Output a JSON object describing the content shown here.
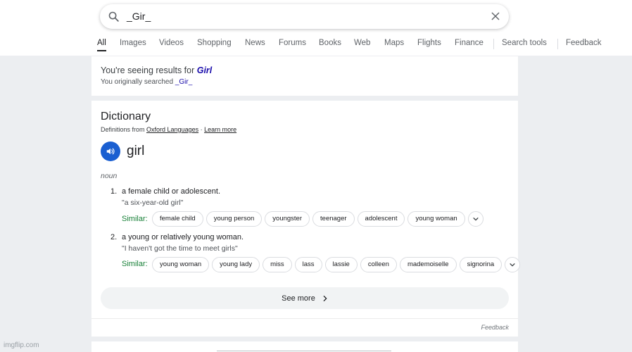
{
  "search": {
    "query": "_Gir_"
  },
  "tabs": [
    {
      "label": "All",
      "active": true
    },
    {
      "label": "Images"
    },
    {
      "label": "Videos"
    },
    {
      "label": "Shopping"
    },
    {
      "label": "News"
    },
    {
      "label": "Forums"
    },
    {
      "label": "Books"
    },
    {
      "label": "Web"
    },
    {
      "label": "Maps"
    },
    {
      "label": "Flights"
    },
    {
      "label": "Finance"
    },
    {
      "label": "Search tools"
    },
    {
      "label": "Feedback"
    }
  ],
  "correction": {
    "prefix": "You're seeing results for ",
    "corrected": "Girl",
    "original_prefix": "You originally searched ",
    "original": "_Gir_"
  },
  "dictionary": {
    "title": "Dictionary",
    "source_prefix": "Definitions from ",
    "source_name": "Oxford Languages",
    "separator": " · ",
    "learn_more": "Learn more",
    "word": "girl",
    "part_of_speech": "noun",
    "similar_label": "Similar:",
    "definitions": [
      {
        "number": "1.",
        "text": "a female child or adolescent.",
        "example": "\"a six-year-old girl\"",
        "similar": [
          "female child",
          "young person",
          "youngster",
          "teenager",
          "adolescent",
          "young woman"
        ]
      },
      {
        "number": "2.",
        "text": "a young or relatively young woman.",
        "example": "\"I haven't got the time to meet girls\"",
        "similar": [
          "young woman",
          "young lady",
          "miss",
          "lass",
          "lassie",
          "colleen",
          "mademoiselle",
          "signorina"
        ]
      }
    ],
    "see_more": "See more",
    "feedback": "Feedback"
  },
  "watermark": "imgflip.com",
  "icons": {
    "search": "search-icon",
    "clear": "close-icon",
    "speaker": "speaker-icon",
    "expand": "chevron-down-icon",
    "see_more": "chevron-right-icon"
  },
  "colors": {
    "link": "#1a0dab",
    "similar": "#188038",
    "speaker_bg": "#1a5fd1"
  }
}
